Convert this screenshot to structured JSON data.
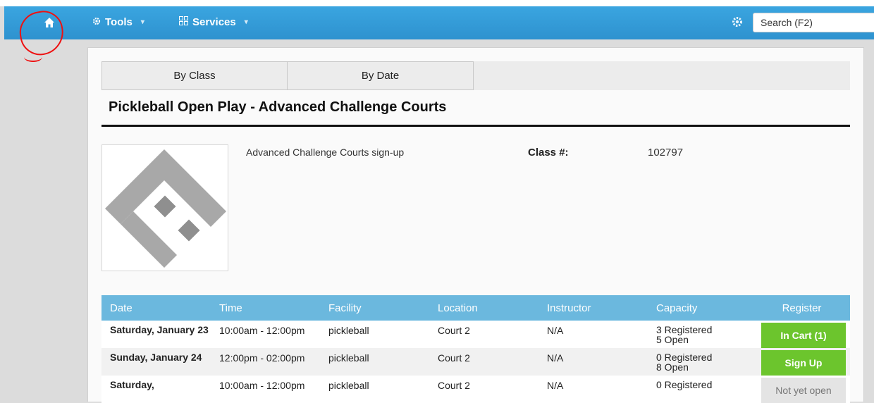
{
  "nav": {
    "tools_label": "Tools",
    "services_label": "Services",
    "search_placeholder": "Search (F2)"
  },
  "tabs": [
    {
      "label": "By Class"
    },
    {
      "label": "By Date"
    }
  ],
  "class_title": "Pickleball Open Play - Advanced Challenge Courts",
  "class_description": "Advanced Challenge Courts sign-up",
  "class_number_label": "Class #:",
  "class_number": "102797",
  "colors": {
    "navbar": "#2e92cf",
    "table_header": "#6bb8de",
    "button_green": "#6cc52d",
    "annotation_red": "#e11111"
  },
  "table": {
    "headers": [
      "Date",
      "Time",
      "Facility",
      "Location",
      "Instructor",
      "Capacity",
      "Register"
    ],
    "rows": [
      {
        "date": "Saturday, January 23",
        "time": "10:00am - 12:00pm",
        "facility": "pickleball",
        "location": "Court 2",
        "instructor": "N/A",
        "registered": "3 Registered",
        "open": "5 Open",
        "button": "In Cart (1)"
      },
      {
        "date": "Sunday, January 24",
        "time": "12:00pm - 02:00pm",
        "facility": "pickleball",
        "location": "Court 2",
        "instructor": "N/A",
        "registered": "0 Registered",
        "open": "8 Open",
        "button": "Sign Up"
      },
      {
        "date": "Saturday,",
        "time": "10:00am - 12:00pm",
        "facility": "pickleball",
        "location": "Court 2",
        "instructor": "N/A",
        "registered": "0 Registered",
        "open": "",
        "button": "Not yet open"
      }
    ]
  }
}
